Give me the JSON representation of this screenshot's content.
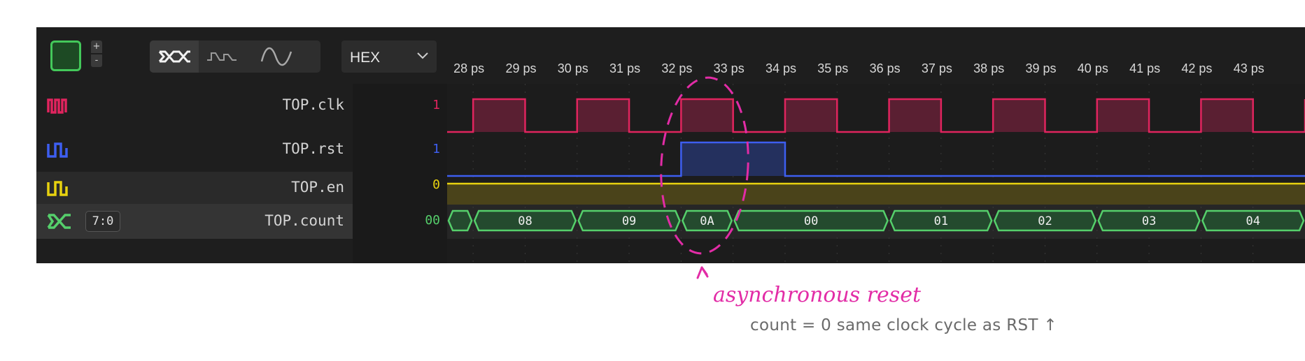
{
  "toolbar": {
    "zoom_in_label": "+",
    "zoom_out_label": "-",
    "radix": "HEX",
    "color_swatch": "#43c85a",
    "icons": [
      "bus-style-icon",
      "step-style-icon",
      "analog-style-icon",
      "chevron-down-icon"
    ]
  },
  "timescale": [
    "28 ps",
    "29 ps",
    "30 ps",
    "31 ps",
    "32 ps",
    "33 ps",
    "34 ps",
    "35 ps",
    "36 ps",
    "37 ps",
    "38 ps",
    "39 ps",
    "40 ps",
    "41 ps",
    "42 ps",
    "43 ps"
  ],
  "signals": [
    {
      "name": "TOP.clk",
      "value": "1",
      "color": "#e0245e",
      "icon": "clock-signal-icon"
    },
    {
      "name": "TOP.rst",
      "value": "1",
      "color": "#3d5ef0",
      "icon": "wire-signal-icon"
    },
    {
      "name": "TOP.en",
      "value": "0",
      "color": "#e8d20f",
      "icon": "wire-signal-icon"
    },
    {
      "name": "TOP.count",
      "value": "00",
      "color": "#55cf6b",
      "icon": "bus-signal-icon",
      "range": "7:0"
    }
  ],
  "waves": {
    "time_start_ps": 27.5,
    "time_end_ps": 44,
    "clk_rising_edges_ps": [
      28,
      30,
      32,
      34,
      36,
      38,
      40,
      42,
      44
    ],
    "clk_period_ps": 2,
    "rst_high_ps": [
      32,
      34
    ],
    "en_level": 0,
    "count_segments": [
      {
        "start": 27.5,
        "end": 28,
        "label": ""
      },
      {
        "start": 28,
        "end": 30,
        "label": "08"
      },
      {
        "start": 30,
        "end": 32,
        "label": "09"
      },
      {
        "start": 32,
        "end": 33,
        "label": "0A"
      },
      {
        "start": 33,
        "end": 36,
        "label": "00"
      },
      {
        "start": 36,
        "end": 38,
        "label": "01"
      },
      {
        "start": 38,
        "end": 40,
        "label": "02"
      },
      {
        "start": 40,
        "end": 42,
        "label": "03"
      },
      {
        "start": 42,
        "end": 44,
        "label": "04"
      }
    ]
  },
  "annotation": {
    "title": "asynchronous reset",
    "note": "count = 0 same clock cycle as RST ↑",
    "color": "#e22ca6",
    "highlight_ps": [
      32,
      33
    ]
  }
}
